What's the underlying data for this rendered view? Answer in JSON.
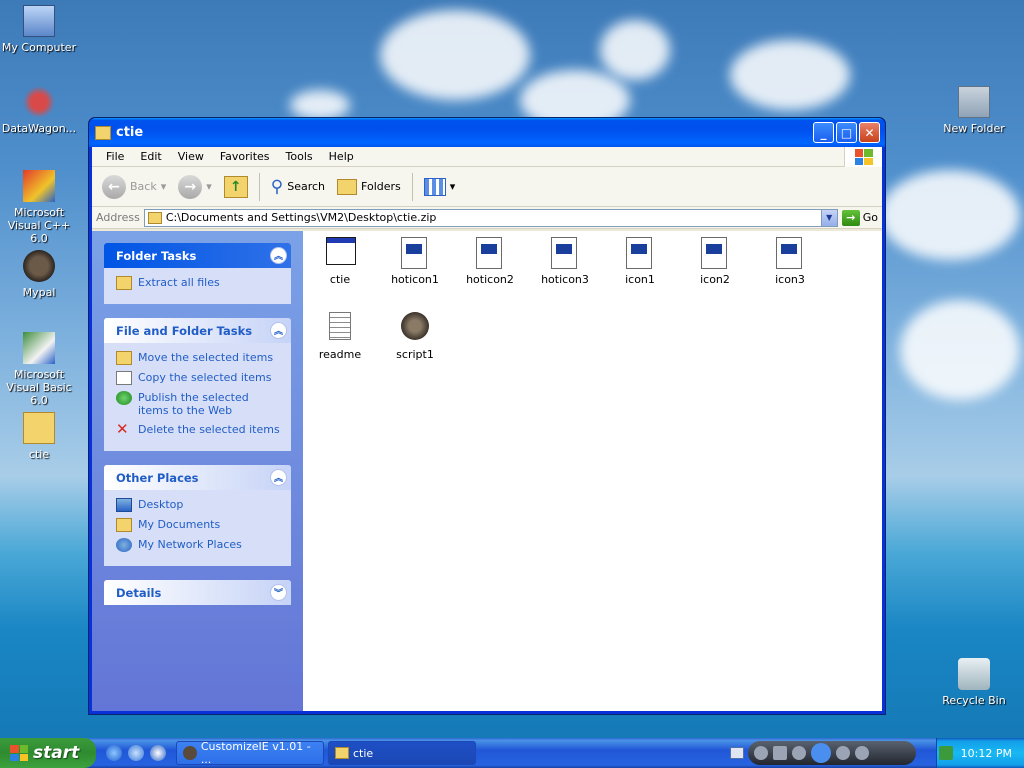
{
  "desktop": {
    "icons": [
      {
        "label": "My Computer",
        "icon": "my-computer-icon"
      },
      {
        "label": "DataWagon...",
        "icon": "datawagon-shortcut-icon"
      },
      {
        "label": "Microsoft Visual C++ 6.0",
        "icon": "visual-cpp-shortcut-icon"
      },
      {
        "label": "Mypal",
        "icon": "mypal-icon"
      },
      {
        "label": "Microsoft Visual Basic 6.0",
        "icon": "visual-basic-shortcut-icon"
      },
      {
        "label": "ctie",
        "icon": "zip-folder-icon"
      },
      {
        "label": "New Folder",
        "icon": "folder-icon"
      },
      {
        "label": "Recycle Bin",
        "icon": "recycle-bin-icon"
      }
    ]
  },
  "window": {
    "title": "ctie",
    "menu": [
      "File",
      "Edit",
      "View",
      "Favorites",
      "Tools",
      "Help"
    ],
    "toolbar": {
      "back": "Back",
      "search": "Search",
      "folders": "Folders"
    },
    "address": {
      "label": "Address",
      "value": "C:\\Documents and Settings\\VM2\\Desktop\\ctie.zip",
      "go": "Go"
    },
    "taskpane": {
      "folder_tasks": {
        "title": "Folder Tasks",
        "items": [
          "Extract all files"
        ]
      },
      "file_folder_tasks": {
        "title": "File and Folder Tasks",
        "items": [
          "Move the selected items",
          "Copy the selected items",
          "Publish the selected items to the Web",
          "Delete the selected items"
        ]
      },
      "other_places": {
        "title": "Other Places",
        "items": [
          "Desktop",
          "My Documents",
          "My Network Places"
        ]
      },
      "details": {
        "title": "Details"
      }
    },
    "files": [
      {
        "name": "ctie",
        "type": "application"
      },
      {
        "name": "hoticon1",
        "type": "bitmap"
      },
      {
        "name": "hoticon2",
        "type": "bitmap"
      },
      {
        "name": "hoticon3",
        "type": "bitmap"
      },
      {
        "name": "icon1",
        "type": "bitmap"
      },
      {
        "name": "icon2",
        "type": "bitmap"
      },
      {
        "name": "icon3",
        "type": "bitmap"
      },
      {
        "name": "readme",
        "type": "text"
      },
      {
        "name": "script1",
        "type": "script"
      }
    ]
  },
  "taskbar": {
    "start": "start",
    "tasks": [
      {
        "label": "CustomizeIE v1.01 - ...",
        "active": false
      },
      {
        "label": "ctie",
        "active": true
      }
    ],
    "clock": "10:12 PM"
  },
  "colors": {
    "title_blue": "#0053ee",
    "taskpane": "#7ba2e7",
    "link": "#215dc6",
    "start_green": "#3c9a3c"
  }
}
